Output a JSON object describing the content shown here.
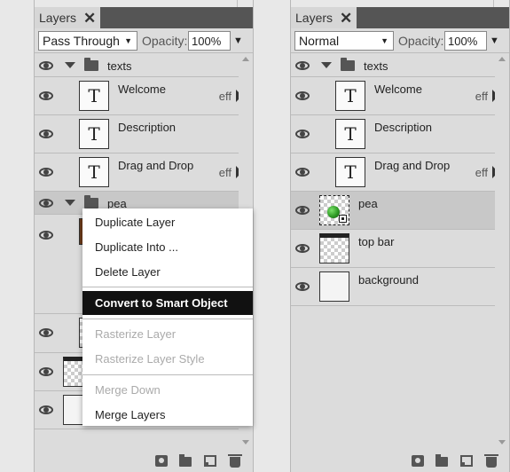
{
  "left_panel": {
    "tab": {
      "label": "Layers",
      "close": "✕"
    },
    "blend_mode": "Pass Through",
    "opacity_label": "Opacity:",
    "opacity_value": "100%",
    "layers": [
      {
        "type": "group",
        "name": "texts"
      },
      {
        "type": "text",
        "name": "Welcome",
        "eff": "eff"
      },
      {
        "type": "text",
        "name": "Description"
      },
      {
        "type": "text",
        "name": "Drag and Drop",
        "eff": "eff"
      },
      {
        "type": "group",
        "name": "pea"
      }
    ],
    "context_menu": {
      "items": [
        {
          "label": "Duplicate Layer",
          "state": "enabled"
        },
        {
          "label": "Duplicate Into ...",
          "state": "enabled"
        },
        {
          "label": "Delete Layer",
          "state": "enabled"
        },
        {
          "label": "Convert to Smart Object",
          "state": "highlighted"
        },
        {
          "label": "Rasterize Layer",
          "state": "disabled"
        },
        {
          "label": "Rasterize Layer Style",
          "state": "disabled"
        },
        {
          "label": "Merge Down",
          "state": "disabled"
        },
        {
          "label": "Merge Layers",
          "state": "enabled"
        }
      ]
    }
  },
  "right_panel": {
    "tab": {
      "label": "Layers",
      "close": "✕"
    },
    "blend_mode": "Normal",
    "opacity_label": "Opacity:",
    "opacity_value": "100%",
    "layers": [
      {
        "type": "group",
        "name": "texts"
      },
      {
        "type": "text",
        "name": "Welcome",
        "eff": "eff"
      },
      {
        "type": "text",
        "name": "Description"
      },
      {
        "type": "text",
        "name": "Drag and Drop",
        "eff": "eff"
      },
      {
        "type": "smart",
        "name": "pea",
        "selected": true
      },
      {
        "type": "raster",
        "name": "top bar"
      },
      {
        "type": "raster",
        "name": "background"
      }
    ]
  },
  "thumb_letter": "T",
  "icons": [
    "eye-icon",
    "folder-icon",
    "caret-down-icon",
    "mask-icon",
    "new-layer-icon",
    "trash-icon"
  ],
  "colors": {
    "highlight_bg": "#111111",
    "pea_green": "#2e9a25"
  }
}
